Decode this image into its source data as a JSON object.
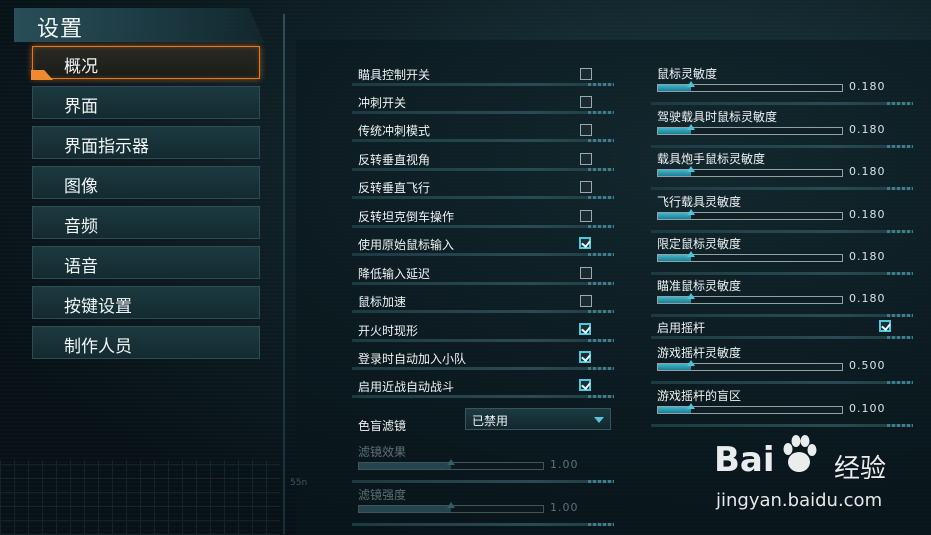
{
  "header": {
    "title": "设置"
  },
  "nav": {
    "items": [
      {
        "label": "概况",
        "active": true
      },
      {
        "label": "界面"
      },
      {
        "label": "界面指示器"
      },
      {
        "label": "图像"
      },
      {
        "label": "音频"
      },
      {
        "label": "语音"
      },
      {
        "label": "按键设置"
      },
      {
        "label": "制作人员"
      }
    ]
  },
  "left_options": [
    {
      "label": "瞄具控制开关",
      "checked": false
    },
    {
      "label": "冲刺开关",
      "checked": false
    },
    {
      "label": "传统冲刺模式",
      "checked": false
    },
    {
      "label": "反转垂直视角",
      "checked": false
    },
    {
      "label": "反转垂直飞行",
      "checked": false
    },
    {
      "label": "反转坦克倒车操作",
      "checked": false
    },
    {
      "label": "使用原始鼠标输入",
      "checked": true
    },
    {
      "label": "降低输入延迟",
      "checked": false
    },
    {
      "label": "鼠标加速",
      "checked": false
    },
    {
      "label": "开火时现形",
      "checked": true
    },
    {
      "label": "登录时自动加入小队",
      "checked": true
    },
    {
      "label": "启用近战自动战斗",
      "checked": true
    }
  ],
  "colorblind": {
    "label": "色盲滤镜",
    "value": "已禁用"
  },
  "filter_sliders": [
    {
      "label": "滤镜效果",
      "value": "1.00",
      "fraction": 0.5
    },
    {
      "label": "滤镜强度",
      "value": "1.00",
      "fraction": 0.5
    }
  ],
  "right_sliders_a": [
    {
      "label": "鼠标灵敏度",
      "value": "0.180",
      "fraction": 0.18
    },
    {
      "label": "驾驶载具时鼠标灵敏度",
      "value": "0.180",
      "fraction": 0.18
    },
    {
      "label": "载具炮手鼠标灵敏度",
      "value": "0.180",
      "fraction": 0.18
    },
    {
      "label": "飞行载具灵敏度",
      "value": "0.180",
      "fraction": 0.18
    },
    {
      "label": "限定鼠标灵敏度",
      "value": "0.180",
      "fraction": 0.18
    },
    {
      "label": "瞄准鼠标灵敏度",
      "value": "0.180",
      "fraction": 0.18
    }
  ],
  "joystick": {
    "label": "启用摇杆",
    "checked": true
  },
  "right_sliders_b": [
    {
      "label": "游戏摇杆灵敏度",
      "value": "0.500",
      "fraction": 0.18
    },
    {
      "label": "游戏摇杆的盲区",
      "value": "0.100",
      "fraction": 0.18
    }
  ],
  "watermark": {
    "brand_a": "Bai",
    "brand_b": "经验",
    "url": "jingyan.baidu.com"
  },
  "background_hint": "55n",
  "colors": {
    "accent": "#4fc8e0",
    "active": "#f08a30"
  }
}
